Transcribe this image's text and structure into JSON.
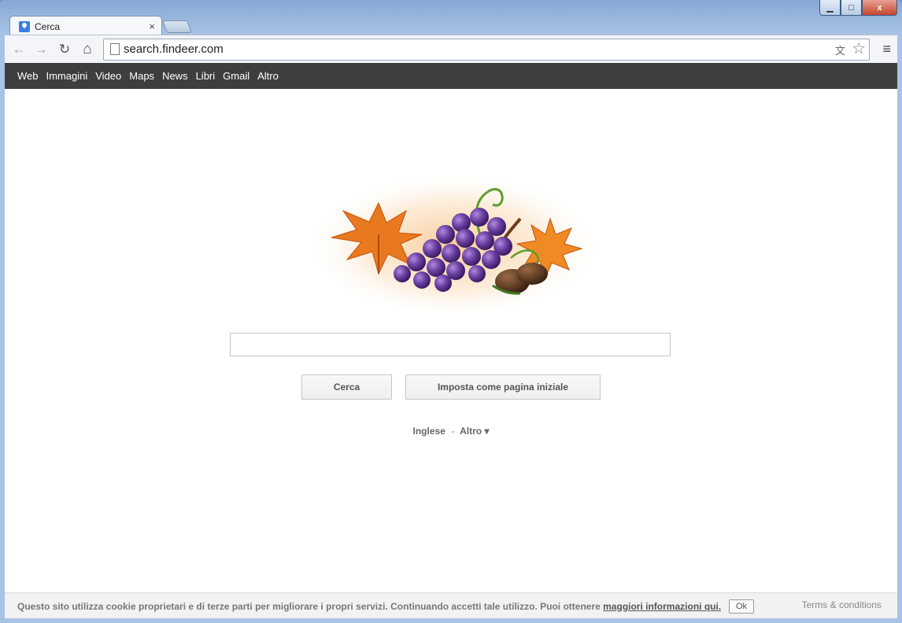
{
  "browser": {
    "tab_title": "Cerca",
    "tab_close": "×",
    "url": "search.findeer.com",
    "icons": {
      "back": "back-arrow-icon",
      "forward": "forward-arrow-icon",
      "reload": "reload-icon",
      "home": "home-icon",
      "star": "star-icon",
      "menu": "menu-icon",
      "translate": "translate-icon"
    },
    "glyphs": {
      "back": "←",
      "forward": "→",
      "reload": "↻",
      "home": "⌂",
      "star": "☆",
      "menu": "≡",
      "translate": "文",
      "minimize": "▁",
      "maximize": "□",
      "close": "x"
    }
  },
  "topnav": {
    "items": [
      "Web",
      "Immagini",
      "Video",
      "Maps",
      "News",
      "Libri",
      "Gmail",
      "Altro"
    ]
  },
  "search": {
    "value": "",
    "button_search": "Cerca",
    "button_homepage": "Imposta come pagina iniziale"
  },
  "language": {
    "current": "Inglese",
    "separator": "-",
    "more": "Altro ▾"
  },
  "footer": {
    "cookie_text": "Questo sito utilizza cookie proprietari e di terze parti per migliorare i propri servizi. Continuando accetti tale utilizzo. Puoi ottenere ",
    "cookie_link": "maggiori informazioni qui.",
    "ok_label": "Ok",
    "terms": "Terms & conditions"
  },
  "colors": {
    "nav_bar": "#3e3e3e",
    "grape": "#6a3fa0",
    "leaf": "#e8791e"
  }
}
